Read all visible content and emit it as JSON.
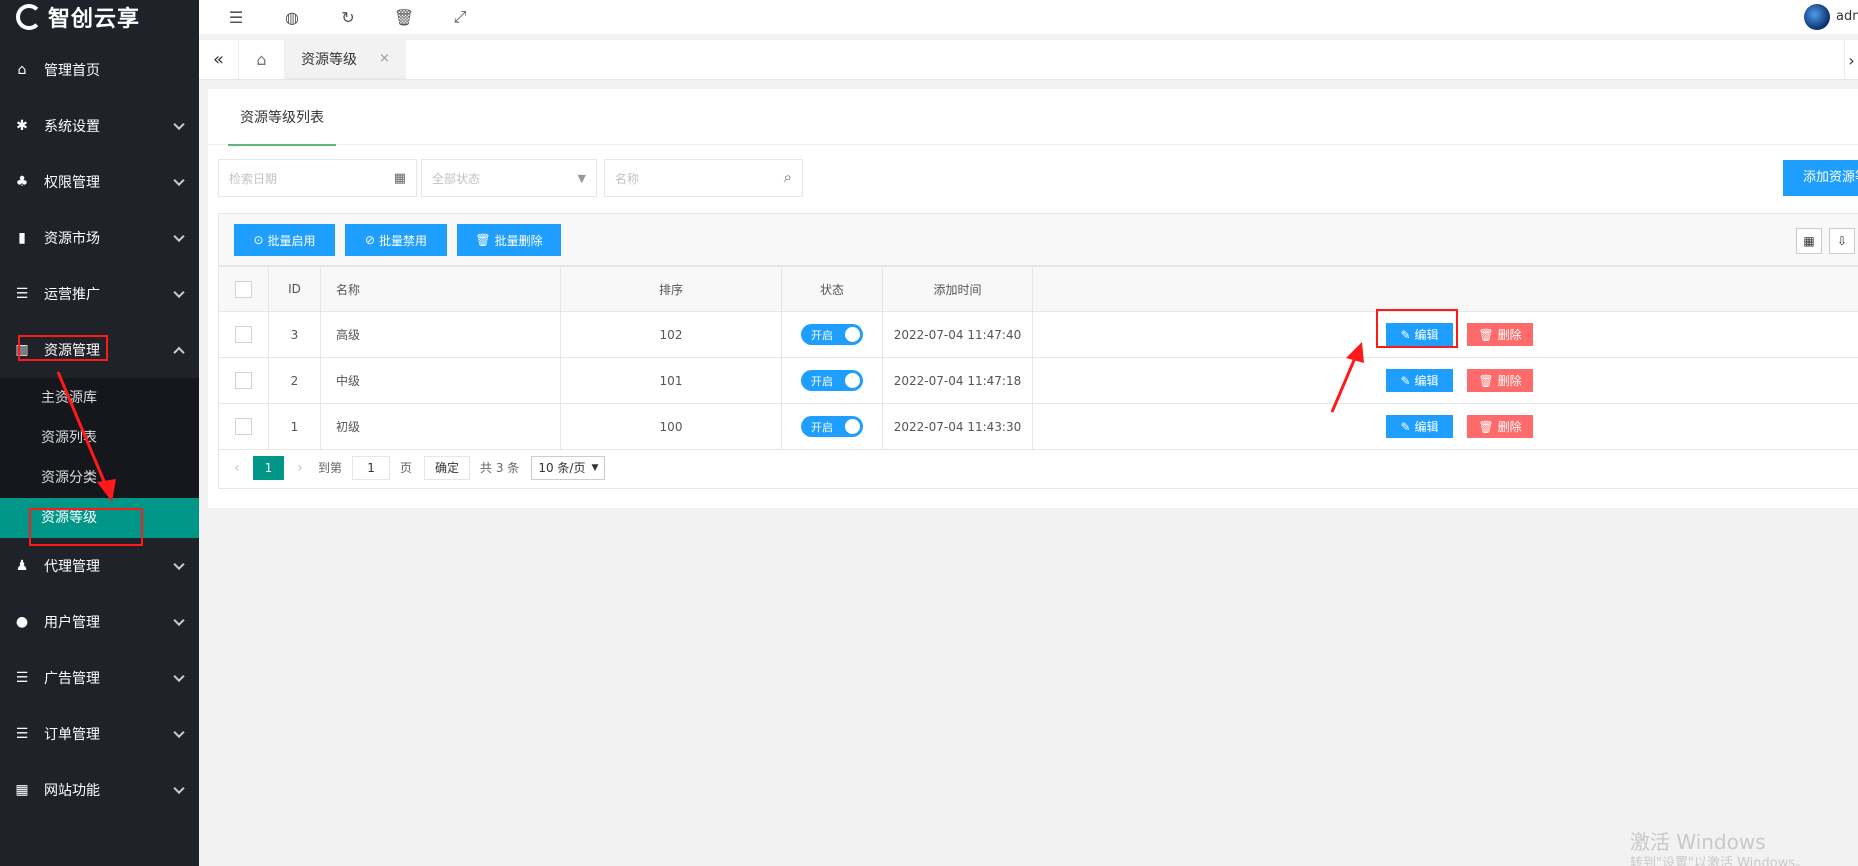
{
  "app": {
    "logo_text": "智创云享",
    "username": "admin"
  },
  "header": {
    "icons": [
      "menu-fold-icon",
      "globe-icon",
      "refresh-icon",
      "trash-icon",
      "fullscreen-icon"
    ]
  },
  "sidebar": {
    "items": [
      {
        "label": "管理首页",
        "icon": "home-icon"
      },
      {
        "label": "系统设置",
        "icon": "gear-icon"
      },
      {
        "label": "权限管理",
        "icon": "users-icon"
      },
      {
        "label": "资源市场",
        "icon": "book-icon"
      },
      {
        "label": "运营推广",
        "icon": "list-icon"
      },
      {
        "label": "资源管理",
        "icon": "columns-icon"
      },
      {
        "label": "代理管理",
        "icon": "group-icon"
      },
      {
        "label": "用户管理",
        "icon": "user-icon"
      },
      {
        "label": "广告管理",
        "icon": "list-icon"
      },
      {
        "label": "订单管理",
        "icon": "list-icon"
      },
      {
        "label": "网站功能",
        "icon": "grid-icon"
      }
    ],
    "submenu": [
      "主资源库",
      "资源列表",
      "资源分类",
      "资源等级"
    ]
  },
  "tabs": {
    "active_label": "资源等级",
    "close": "×"
  },
  "card": {
    "title": "资源等级列表"
  },
  "filters": {
    "date_placeholder": "检索日期",
    "status_placeholder": "全部状态",
    "name_placeholder": "名称",
    "add_label": "添加资源等级"
  },
  "toolbar": {
    "enable_label": "批量启用",
    "disable_label": "批量禁用",
    "delete_label": "批量删除"
  },
  "table": {
    "headers": [
      "ID",
      "名称",
      "排序",
      "状态",
      "添加时间"
    ],
    "rows": [
      {
        "id": "3",
        "name": "高级",
        "sort": "102",
        "status": "开启",
        "time": "2022-07-04 11:47:40"
      },
      {
        "id": "2",
        "name": "中级",
        "sort": "101",
        "status": "开启",
        "time": "2022-07-04 11:47:18"
      },
      {
        "id": "1",
        "name": "初级",
        "sort": "100",
        "status": "开启",
        "time": "2022-07-04 11:43:30"
      }
    ],
    "edit_label": "编辑",
    "delete_label": "删除"
  },
  "pager": {
    "current": "1",
    "goto_label": "到第",
    "page_input": "1",
    "page_unit": "页",
    "confirm_label": "确定",
    "total": "共 3 条",
    "page_size": "10 条/页"
  },
  "watermark": {
    "line1": "激活 Windows",
    "line2": "转到\"设置\"以激活 Windows。"
  },
  "colors": {
    "sidebar": "#20222a",
    "active": "#009688",
    "primary": "#1e9fff",
    "danger": "#ff6b6b"
  }
}
